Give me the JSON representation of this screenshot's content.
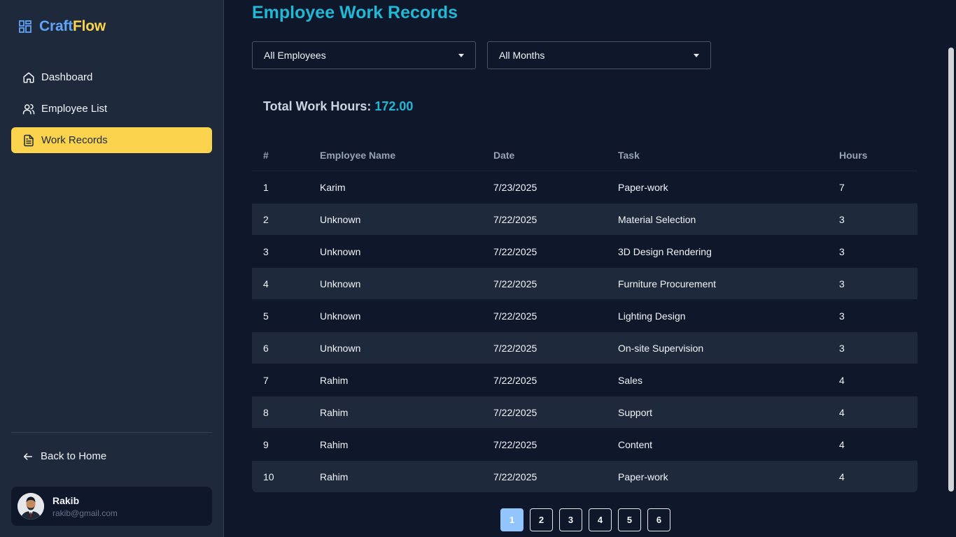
{
  "brand": {
    "part1": "Craft",
    "part2": "Flow"
  },
  "sidebar": {
    "items": [
      {
        "label": "Dashboard",
        "icon": "home-icon"
      },
      {
        "label": "Employee List",
        "icon": "users-icon"
      },
      {
        "label": "Work Records",
        "icon": "document-icon",
        "active": true
      }
    ],
    "back_label": "Back to Home",
    "user": {
      "name": "Rakib",
      "email": "rakib@gmail.com"
    }
  },
  "main": {
    "title": "Employee Work Records",
    "filters": {
      "employee": "All Employees",
      "month": "All Months"
    },
    "total_label": "Total Work Hours:",
    "total_value": "172.00",
    "table": {
      "headers": [
        "#",
        "Employee Name",
        "Date",
        "Task",
        "Hours"
      ],
      "rows": [
        [
          "1",
          "Karim",
          "7/23/2025",
          "Paper-work",
          "7"
        ],
        [
          "2",
          "Unknown",
          "7/22/2025",
          "Material Selection",
          "3"
        ],
        [
          "3",
          "Unknown",
          "7/22/2025",
          "3D Design Rendering",
          "3"
        ],
        [
          "4",
          "Unknown",
          "7/22/2025",
          "Furniture Procurement",
          "3"
        ],
        [
          "5",
          "Unknown",
          "7/22/2025",
          "Lighting Design",
          "3"
        ],
        [
          "6",
          "Unknown",
          "7/22/2025",
          "On-site Supervision",
          "3"
        ],
        [
          "7",
          "Rahim",
          "7/22/2025",
          "Sales",
          "4"
        ],
        [
          "8",
          "Rahim",
          "7/22/2025",
          "Support",
          "4"
        ],
        [
          "9",
          "Rahim",
          "7/22/2025",
          "Content",
          "4"
        ],
        [
          "10",
          "Rahim",
          "7/22/2025",
          "Paper-work",
          "4"
        ]
      ]
    },
    "pagination": {
      "pages": [
        "1",
        "2",
        "3",
        "4",
        "5",
        "6"
      ],
      "current": "1"
    }
  },
  "colors": {
    "background": "#0f172a",
    "sidebar": "#1e293b",
    "accent_yellow": "#fcd34d",
    "accent_cyan": "#22b8d4",
    "brand_blue": "#60a5fa"
  }
}
